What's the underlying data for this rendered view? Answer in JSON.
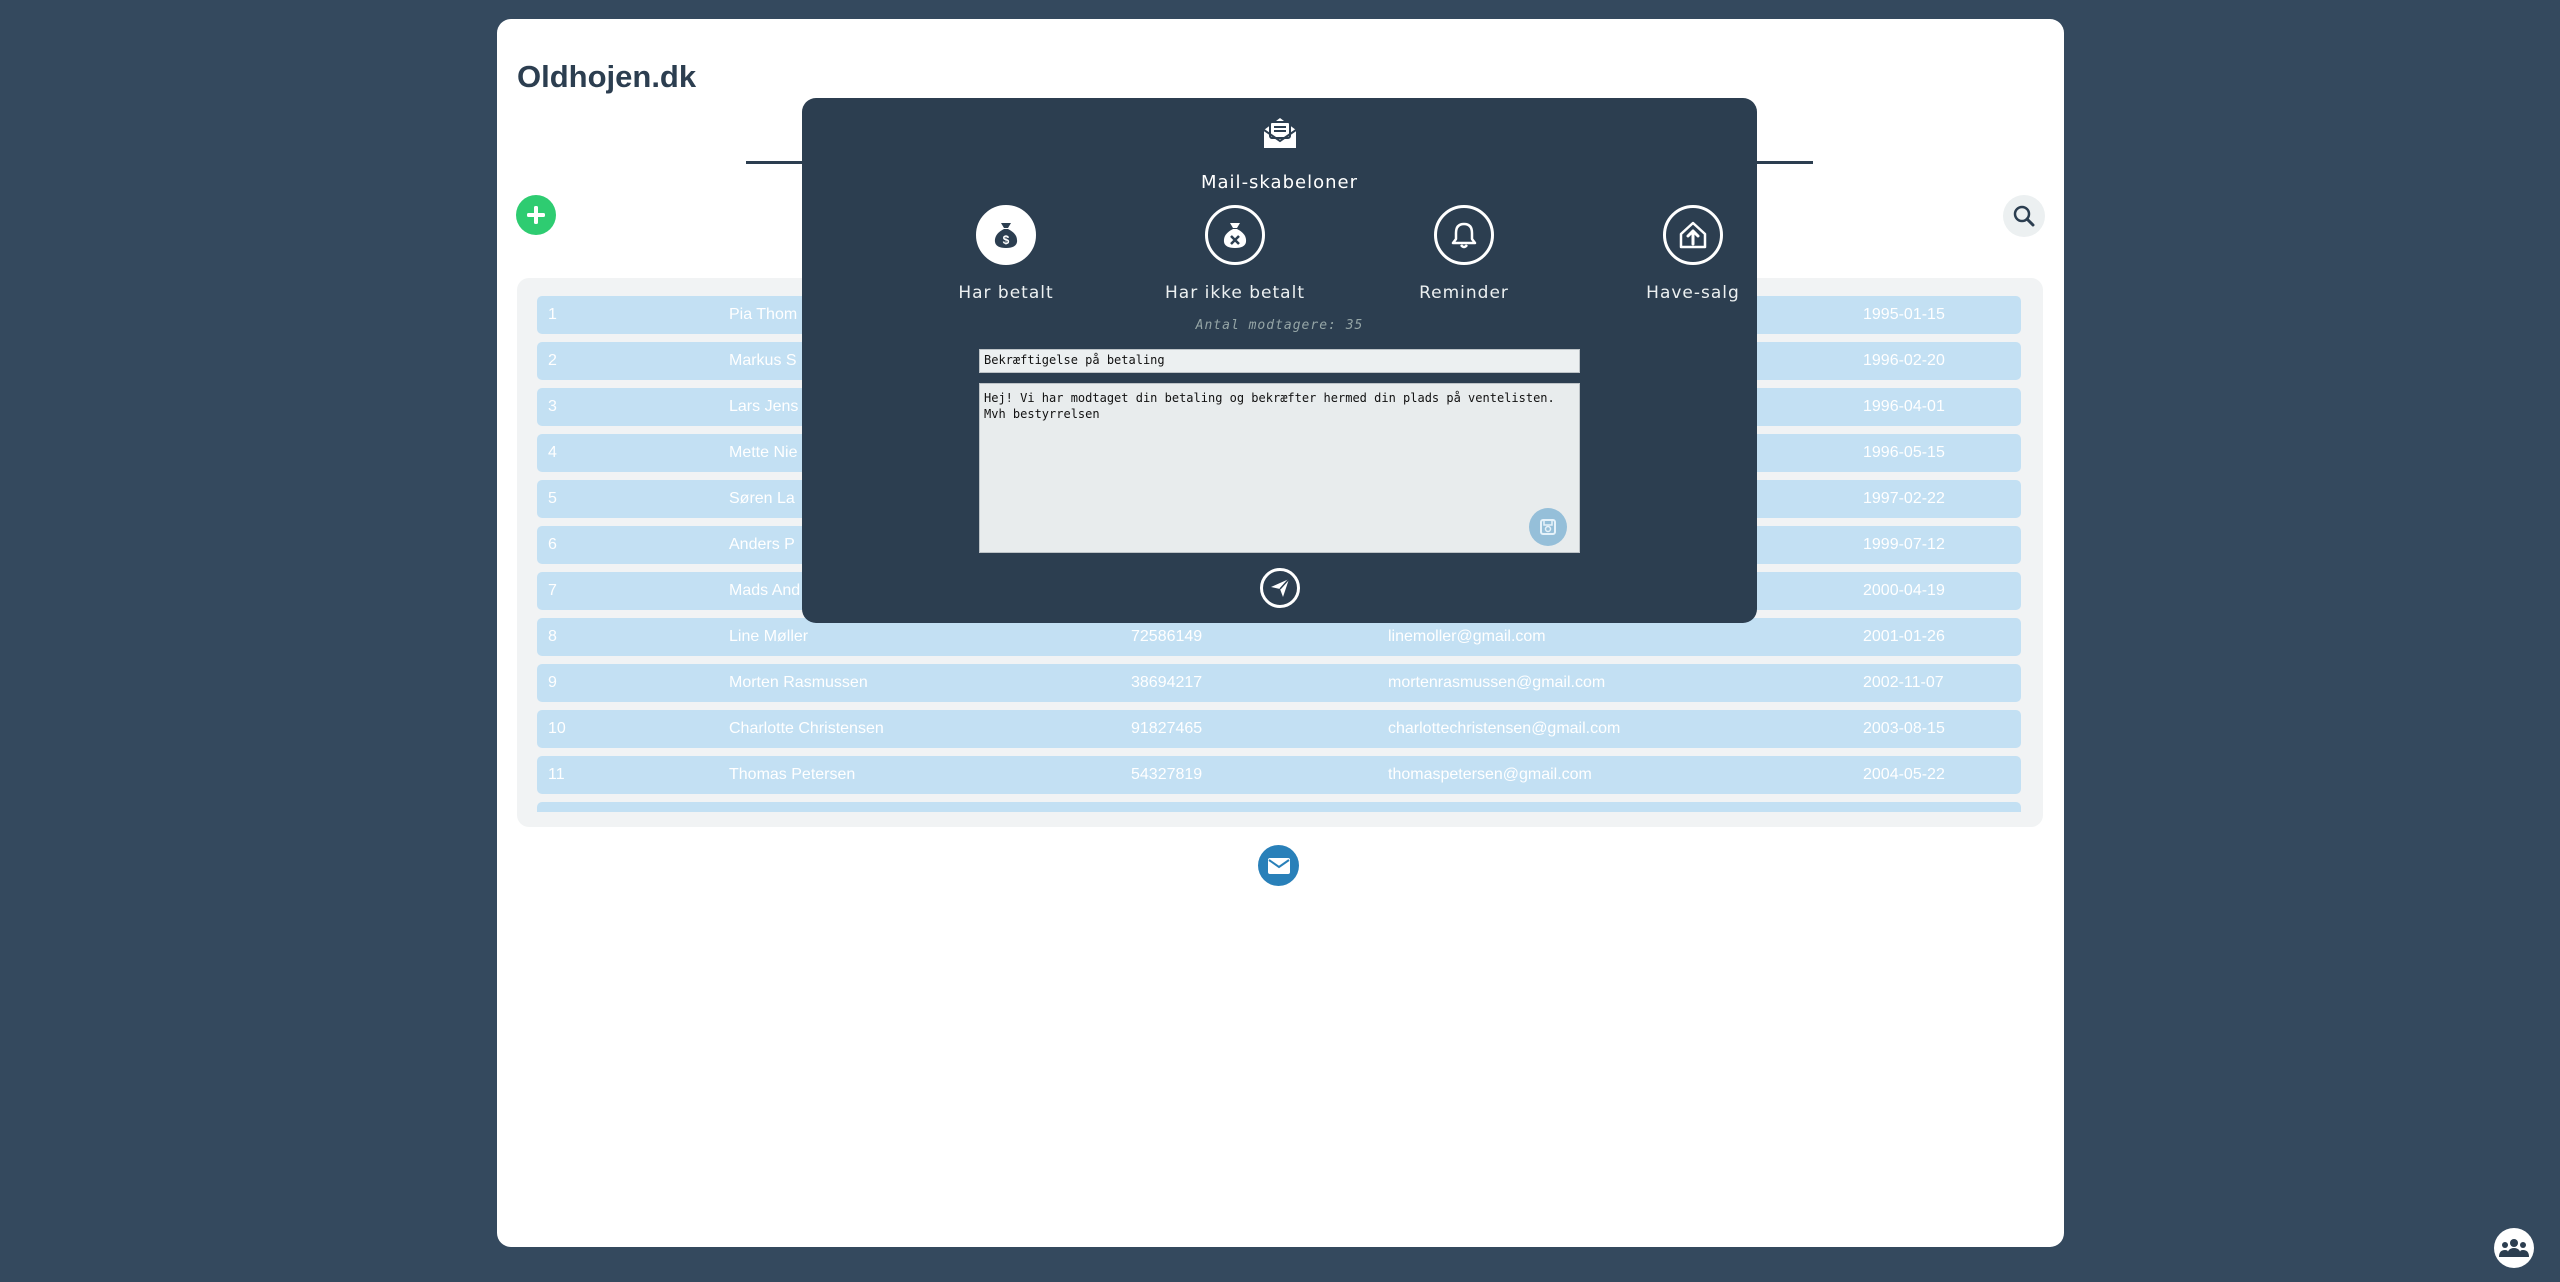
{
  "header": {
    "site_title": "Oldhojen.dk"
  },
  "colors": {
    "background": "#34495e",
    "modal": "#2c3e50",
    "row": "#c3e0f3",
    "add": "#2ecc71",
    "mail": "#2980b9"
  },
  "table": {
    "rows": [
      {
        "num": "1",
        "name": "Pia Thom",
        "phone": "",
        "email": "",
        "date": "1995-01-15"
      },
      {
        "num": "2",
        "name": "Markus S",
        "phone": "",
        "email": "",
        "date": "1996-02-20"
      },
      {
        "num": "3",
        "name": "Lars Jens",
        "phone": "",
        "email": "",
        "date": "1996-04-01"
      },
      {
        "num": "4",
        "name": "Mette Nie",
        "phone": "",
        "email": "",
        "date": "1996-05-15"
      },
      {
        "num": "5",
        "name": "Søren La",
        "phone": "",
        "email": "",
        "date": "1997-02-22"
      },
      {
        "num": "6",
        "name": "Anders P",
        "phone": "",
        "email": "",
        "date": "1999-07-12"
      },
      {
        "num": "7",
        "name": "Mads And",
        "phone": "",
        "email": "",
        "date": "2000-04-19"
      },
      {
        "num": "8",
        "name": "Line Møller",
        "phone": "72586149",
        "email": "linemoller@gmail.com",
        "date": "2001-01-26"
      },
      {
        "num": "9",
        "name": "Morten Rasmussen",
        "phone": "38694217",
        "email": "mortenrasmussen@gmail.com",
        "date": "2002-11-07"
      },
      {
        "num": "10",
        "name": "Charlotte Christensen",
        "phone": "91827465",
        "email": "charlottechristensen@gmail.com",
        "date": "2003-08-15"
      },
      {
        "num": "11",
        "name": "Thomas Petersen",
        "phone": "54327819",
        "email": "thomaspetersen@gmail.com",
        "date": "2004-05-22"
      }
    ]
  },
  "modal": {
    "title": "Mail-skabeloner",
    "templates": [
      {
        "label": "Har betalt",
        "icon": "money-bag-dollar-icon",
        "active": true
      },
      {
        "label": "Har ikke betalt",
        "icon": "money-bag-x-icon",
        "active": false
      },
      {
        "label": "Reminder",
        "icon": "bell-icon",
        "active": false
      },
      {
        "label": "Have-salg",
        "icon": "house-up-arrow-icon",
        "active": false
      }
    ],
    "recipients": "Antal modtagere: 35",
    "subject": "Bekræftigelse på betaling",
    "body": "Hej! Vi har modtaget din betaling og bekræfter hermed din plads på ventelisten.\nMvh bestyrrelsen"
  },
  "icons": {
    "add": "plus-icon",
    "search": "search-icon",
    "mail": "envelope-icon",
    "save": "save-icon",
    "send": "paper-plane-icon",
    "fab": "people-group-icon"
  }
}
